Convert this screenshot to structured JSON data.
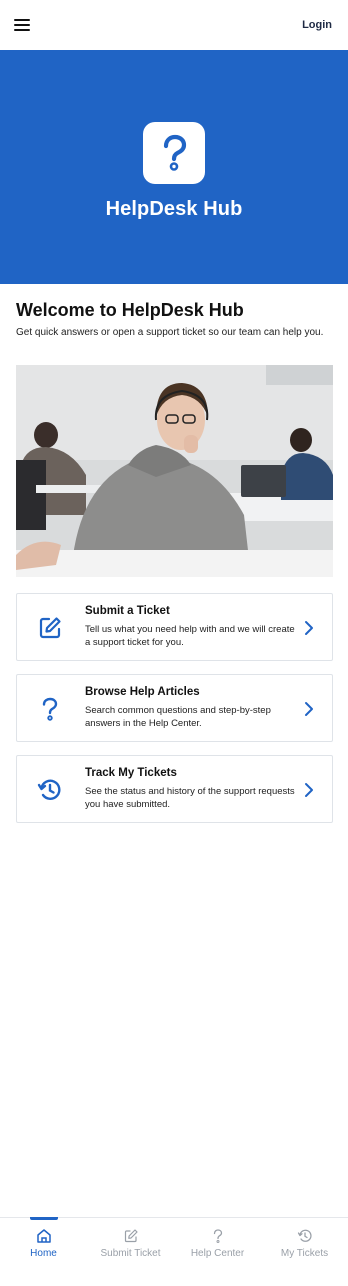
{
  "header": {
    "login_label": "Login"
  },
  "hero": {
    "app_name": "HelpDesk Hub",
    "brand_color": "#2064c5"
  },
  "welcome": {
    "title": "Welcome to HelpDesk Hub",
    "subtitle": "Get quick answers or open a support ticket so our team can help you."
  },
  "cards": [
    {
      "icon": "edit-icon",
      "title": "Submit a Ticket",
      "description": "Tell us what you need help with and we will create a support ticket for you."
    },
    {
      "icon": "question-icon",
      "title": "Browse Help Articles",
      "description": "Search common questions and step-by-step answers in the Help Center."
    },
    {
      "icon": "history-icon",
      "title": "Track My Tickets",
      "description": "See the status and history of the support requests you have submitted."
    }
  ],
  "bottom_nav": [
    {
      "icon": "home-icon",
      "label": "Home",
      "active": true
    },
    {
      "icon": "edit-icon",
      "label": "Submit Ticket",
      "active": false
    },
    {
      "icon": "question-icon",
      "label": "Help Center",
      "active": false
    },
    {
      "icon": "history-icon",
      "label": "My Tickets",
      "active": false
    }
  ]
}
